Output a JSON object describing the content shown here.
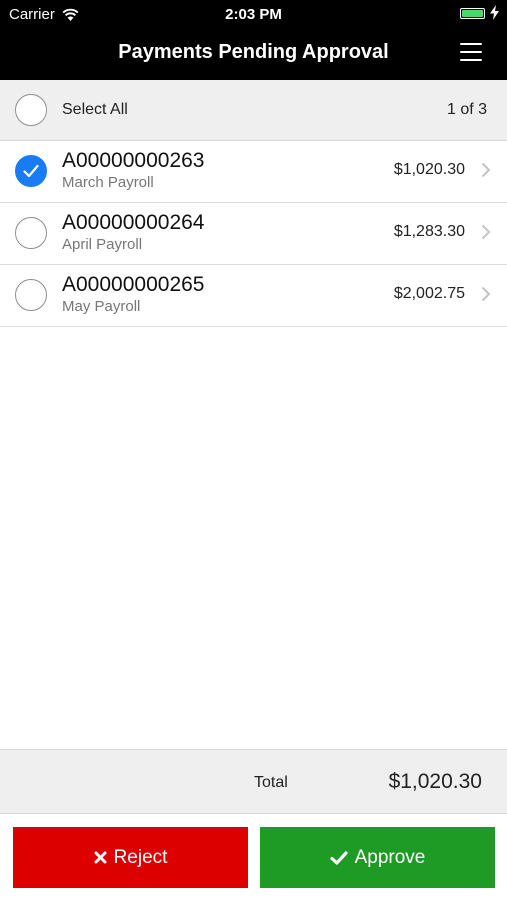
{
  "status_bar": {
    "carrier": "Carrier",
    "time": "2:03 PM",
    "battery_level": 1.0,
    "battery_color": "#4cd964"
  },
  "nav": {
    "title": "Payments Pending Approval",
    "menu_icon": "hamburger-menu-icon"
  },
  "select_all": {
    "label": "Select All",
    "checked": false,
    "page_indicator": "1 of 3"
  },
  "payments": [
    {
      "id": "A00000000263",
      "description": "March Payroll",
      "amount": "$1,020.30",
      "checked": true
    },
    {
      "id": "A00000000264",
      "description": "April Payroll",
      "amount": "$1,283.30",
      "checked": false
    },
    {
      "id": "A00000000265",
      "description": "May Payroll",
      "amount": "$2,002.75",
      "checked": false
    }
  ],
  "total": {
    "label": "Total",
    "value": "$1,020.30"
  },
  "actions": {
    "reject_label": "Reject",
    "approve_label": "Approve",
    "reject_icon": "x-icon",
    "approve_icon": "checkmark-icon"
  },
  "colors": {
    "checked_accent": "#1a7cf4",
    "reject": "#dc0000",
    "approve": "#1e9b25"
  }
}
